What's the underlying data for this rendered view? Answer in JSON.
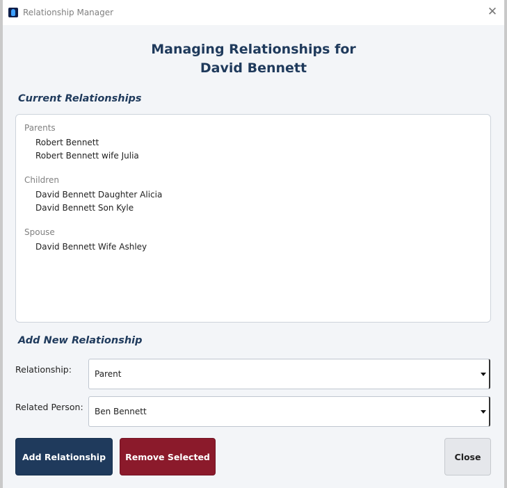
{
  "window": {
    "title": "Relationship Manager"
  },
  "heading": {
    "line1": "Managing Relationships for",
    "line2": "David Bennett"
  },
  "current_section": {
    "label": "Current Relationships",
    "groups": [
      {
        "title": "Parents",
        "items": [
          "Robert Bennett",
          "Robert Bennett wife Julia"
        ]
      },
      {
        "title": "Children",
        "items": [
          "David Bennett Daughter Alicia",
          "David Bennett Son Kyle"
        ]
      },
      {
        "title": "Spouse",
        "items": [
          "David Bennett Wife Ashley"
        ]
      }
    ]
  },
  "add_section": {
    "label": "Add New Relationship",
    "relationship_label": "Relationship:",
    "relationship_value": "Parent",
    "person_label": "Related Person:",
    "person_value": "Ben Bennett"
  },
  "buttons": {
    "add": "Add Relationship",
    "remove": "Remove Selected",
    "close": "Close"
  },
  "colors": {
    "primary": "#1f3a5c",
    "danger": "#8b1a2b",
    "neutral": "#e5e7eb"
  },
  "icons": {
    "app": "app-icon",
    "close": "close-icon",
    "dropdown": "chevron-down-icon"
  }
}
